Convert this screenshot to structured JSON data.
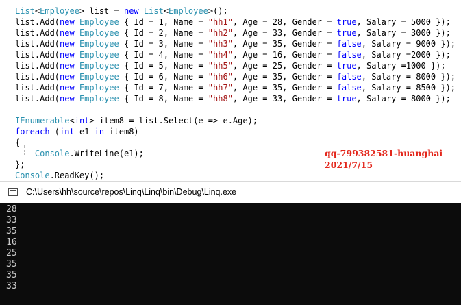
{
  "colors": {
    "type": "#2b91af",
    "keyword": "#0000ff",
    "string": "#a31515",
    "plain": "#000000",
    "watermark": "#e3261b",
    "console_bg": "#0c0c0c",
    "console_text": "#cccccc"
  },
  "editor": {
    "lines": [
      [
        {
          "t": "List",
          "c": "type"
        },
        {
          "t": "<",
          "c": "plain"
        },
        {
          "t": "Employee",
          "c": "type"
        },
        {
          "t": "> list = ",
          "c": "plain"
        },
        {
          "t": "new",
          "c": "kw"
        },
        {
          "t": " ",
          "c": "plain"
        },
        {
          "t": "List",
          "c": "type"
        },
        {
          "t": "<",
          "c": "plain"
        },
        {
          "t": "Employee",
          "c": "type"
        },
        {
          "t": ">();",
          "c": "plain"
        }
      ],
      [
        {
          "t": "list.Add(",
          "c": "plain"
        },
        {
          "t": "new",
          "c": "kw"
        },
        {
          "t": " ",
          "c": "plain"
        },
        {
          "t": "Employee",
          "c": "type"
        },
        {
          "t": " { Id = 1, Name = ",
          "c": "plain"
        },
        {
          "t": "\"hh1\"",
          "c": "str"
        },
        {
          "t": ", Age = 28, Gender = ",
          "c": "plain"
        },
        {
          "t": "true",
          "c": "kw"
        },
        {
          "t": ", Salary = 5000 });",
          "c": "plain"
        }
      ],
      [
        {
          "t": "list.Add(",
          "c": "plain"
        },
        {
          "t": "new",
          "c": "kw"
        },
        {
          "t": " ",
          "c": "plain"
        },
        {
          "t": "Employee",
          "c": "type"
        },
        {
          "t": " { Id = 2, Name = ",
          "c": "plain"
        },
        {
          "t": "\"hh2\"",
          "c": "str"
        },
        {
          "t": ", Age = 33, Gender = ",
          "c": "plain"
        },
        {
          "t": "true",
          "c": "kw"
        },
        {
          "t": ", Salary = 3000 });",
          "c": "plain"
        }
      ],
      [
        {
          "t": "list.Add(",
          "c": "plain"
        },
        {
          "t": "new",
          "c": "kw"
        },
        {
          "t": " ",
          "c": "plain"
        },
        {
          "t": "Employee",
          "c": "type"
        },
        {
          "t": " { Id = 3, Name = ",
          "c": "plain"
        },
        {
          "t": "\"hh3\"",
          "c": "str"
        },
        {
          "t": ", Age = 35, Gender = ",
          "c": "plain"
        },
        {
          "t": "false",
          "c": "kw"
        },
        {
          "t": ", Salary = 9000 });",
          "c": "plain"
        }
      ],
      [
        {
          "t": "list.Add(",
          "c": "plain"
        },
        {
          "t": "new",
          "c": "kw"
        },
        {
          "t": " ",
          "c": "plain"
        },
        {
          "t": "Employee",
          "c": "type"
        },
        {
          "t": " { Id = 4, Name = ",
          "c": "plain"
        },
        {
          "t": "\"hh4\"",
          "c": "str"
        },
        {
          "t": ", Age = 16, Gender = ",
          "c": "plain"
        },
        {
          "t": "false",
          "c": "kw"
        },
        {
          "t": ", Salary =2000 });",
          "c": "plain"
        }
      ],
      [
        {
          "t": "list.Add(",
          "c": "plain"
        },
        {
          "t": "new",
          "c": "kw"
        },
        {
          "t": " ",
          "c": "plain"
        },
        {
          "t": "Employee",
          "c": "type"
        },
        {
          "t": " { Id = 5, Name = ",
          "c": "plain"
        },
        {
          "t": "\"hh5\"",
          "c": "str"
        },
        {
          "t": ", Age = 25, Gender = ",
          "c": "plain"
        },
        {
          "t": "true",
          "c": "kw"
        },
        {
          "t": ", Salary =1000 });",
          "c": "plain"
        }
      ],
      [
        {
          "t": "list.Add(",
          "c": "plain"
        },
        {
          "t": "new",
          "c": "kw"
        },
        {
          "t": " ",
          "c": "plain"
        },
        {
          "t": "Employee",
          "c": "type"
        },
        {
          "t": " { Id = 6, Name = ",
          "c": "plain"
        },
        {
          "t": "\"hh6\"",
          "c": "str"
        },
        {
          "t": ", Age = 35, Gender = ",
          "c": "plain"
        },
        {
          "t": "false",
          "c": "kw"
        },
        {
          "t": ", Salary = 8000 });",
          "c": "plain"
        }
      ],
      [
        {
          "t": "list.Add(",
          "c": "plain"
        },
        {
          "t": "new",
          "c": "kw"
        },
        {
          "t": " ",
          "c": "plain"
        },
        {
          "t": "Employee",
          "c": "type"
        },
        {
          "t": " { Id = 7, Name = ",
          "c": "plain"
        },
        {
          "t": "\"hh7\"",
          "c": "str"
        },
        {
          "t": ", Age = 35, Gender = ",
          "c": "plain"
        },
        {
          "t": "false",
          "c": "kw"
        },
        {
          "t": ", Salary = 8500 });",
          "c": "plain"
        }
      ],
      [
        {
          "t": "list.Add(",
          "c": "plain"
        },
        {
          "t": "new",
          "c": "kw"
        },
        {
          "t": " ",
          "c": "plain"
        },
        {
          "t": "Employee",
          "c": "type"
        },
        {
          "t": " { Id = 8, Name = ",
          "c": "plain"
        },
        {
          "t": "\"hh8\"",
          "c": "str"
        },
        {
          "t": ", Age = 33, Gender = ",
          "c": "plain"
        },
        {
          "t": "true",
          "c": "kw"
        },
        {
          "t": ", Salary = 8000 });",
          "c": "plain"
        }
      ],
      [],
      [
        {
          "t": "IEnumerable",
          "c": "type"
        },
        {
          "t": "<",
          "c": "plain"
        },
        {
          "t": "int",
          "c": "kw"
        },
        {
          "t": "> item8 = list.Select(e => e.Age);",
          "c": "plain"
        }
      ],
      [
        {
          "t": "foreach",
          "c": "kw"
        },
        {
          "t": " (",
          "c": "plain"
        },
        {
          "t": "int",
          "c": "kw"
        },
        {
          "t": " e1 ",
          "c": "plain"
        },
        {
          "t": "in",
          "c": "kw"
        },
        {
          "t": " item8)",
          "c": "plain"
        }
      ],
      [
        {
          "t": "{",
          "c": "plain"
        }
      ],
      [
        {
          "t": "    ",
          "c": "plain"
        },
        {
          "t": "Console",
          "c": "type"
        },
        {
          "t": ".WriteLine(e1);",
          "c": "plain"
        }
      ],
      [
        {
          "t": "};",
          "c": "plain"
        }
      ],
      [
        {
          "t": "Console",
          "c": "type"
        },
        {
          "t": ".ReadKey();",
          "c": "plain"
        }
      ]
    ]
  },
  "watermark": {
    "line1": "qq-799382581-huanghai",
    "line2": "2021/7/15"
  },
  "console": {
    "title": "C:\\Users\\hh\\source\\repos\\Linq\\Linq\\bin\\Debug\\Linq.exe",
    "output": [
      "28",
      "33",
      "35",
      "16",
      "25",
      "35",
      "35",
      "33"
    ]
  }
}
